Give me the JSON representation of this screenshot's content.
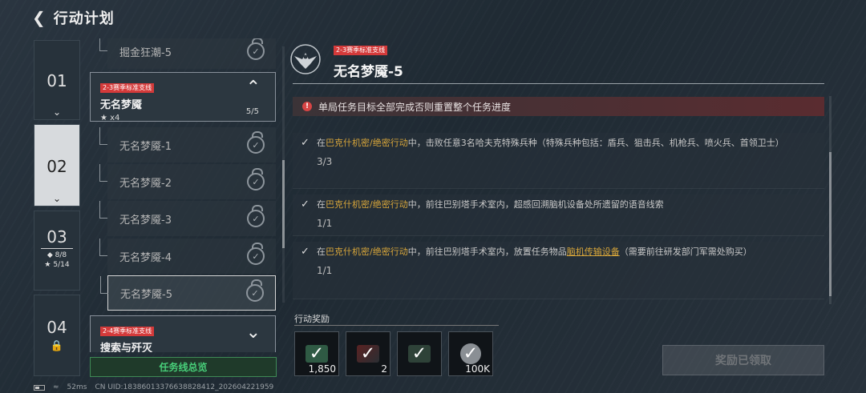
{
  "header": {
    "title": "行动计划"
  },
  "chapters": [
    {
      "num": "01"
    },
    {
      "num": "02"
    },
    {
      "num": "03",
      "diamonds": "◆ 8/8",
      "stars": "★ 5/14"
    },
    {
      "num": "04"
    }
  ],
  "list": {
    "prev_item": "掘金狂潮-5",
    "group1": {
      "tag": "2-3赛季标准支线",
      "name": "无名梦魇",
      "stars": "★ x4",
      "progress": "5/5"
    },
    "items": [
      "无名梦魇-1",
      "无名梦魇-2",
      "无名梦魇-3",
      "无名梦魇-4",
      "无名梦魇-5"
    ],
    "group2": {
      "tag": "2-4赛季标准支线",
      "name": "搜索与歼灭"
    },
    "overview_label": "任务线总览"
  },
  "detail": {
    "tag": "2-3赛季标准支线",
    "title": "无名梦魇-5",
    "warning": "单局任务目标全部完成否则重置整个任务进度",
    "tasks": [
      {
        "pre": "在",
        "hl": "巴克什机密/绝密行动",
        "text": "中，击败任意3名哈夫克特殊兵种（特殊兵种包括：盾兵、狙击兵、机枪兵、喷火兵、首领卫士）",
        "count": "3/3"
      },
      {
        "pre": "在",
        "hl": "巴克什机密/绝密行动",
        "text": "中，前往巴别塔手术室内，超感回溯脑机设备处所遗留的语音线索",
        "count": "1/1"
      },
      {
        "pre": "在",
        "hl": "巴克什机密/绝密行动",
        "text1": "中，前往巴别塔手术室内，放置任务物品",
        "item": "脑机传输设备",
        "text2": "（需要前往研发部门军需处购买）",
        "count": "1/1"
      }
    ],
    "reward_label": "行动奖励",
    "rewards": [
      {
        "icon": "ammo-box-icon",
        "value": "1,850"
      },
      {
        "icon": "weapon-icon",
        "value": "2"
      },
      {
        "icon": "item-crate-icon",
        "value": ""
      },
      {
        "icon": "coin-icon",
        "value": "100K"
      }
    ],
    "claim_label": "奖励已领取"
  },
  "footer": {
    "ping": "52ms",
    "uid": "CN UID:18386013376638828412_202604221959"
  }
}
